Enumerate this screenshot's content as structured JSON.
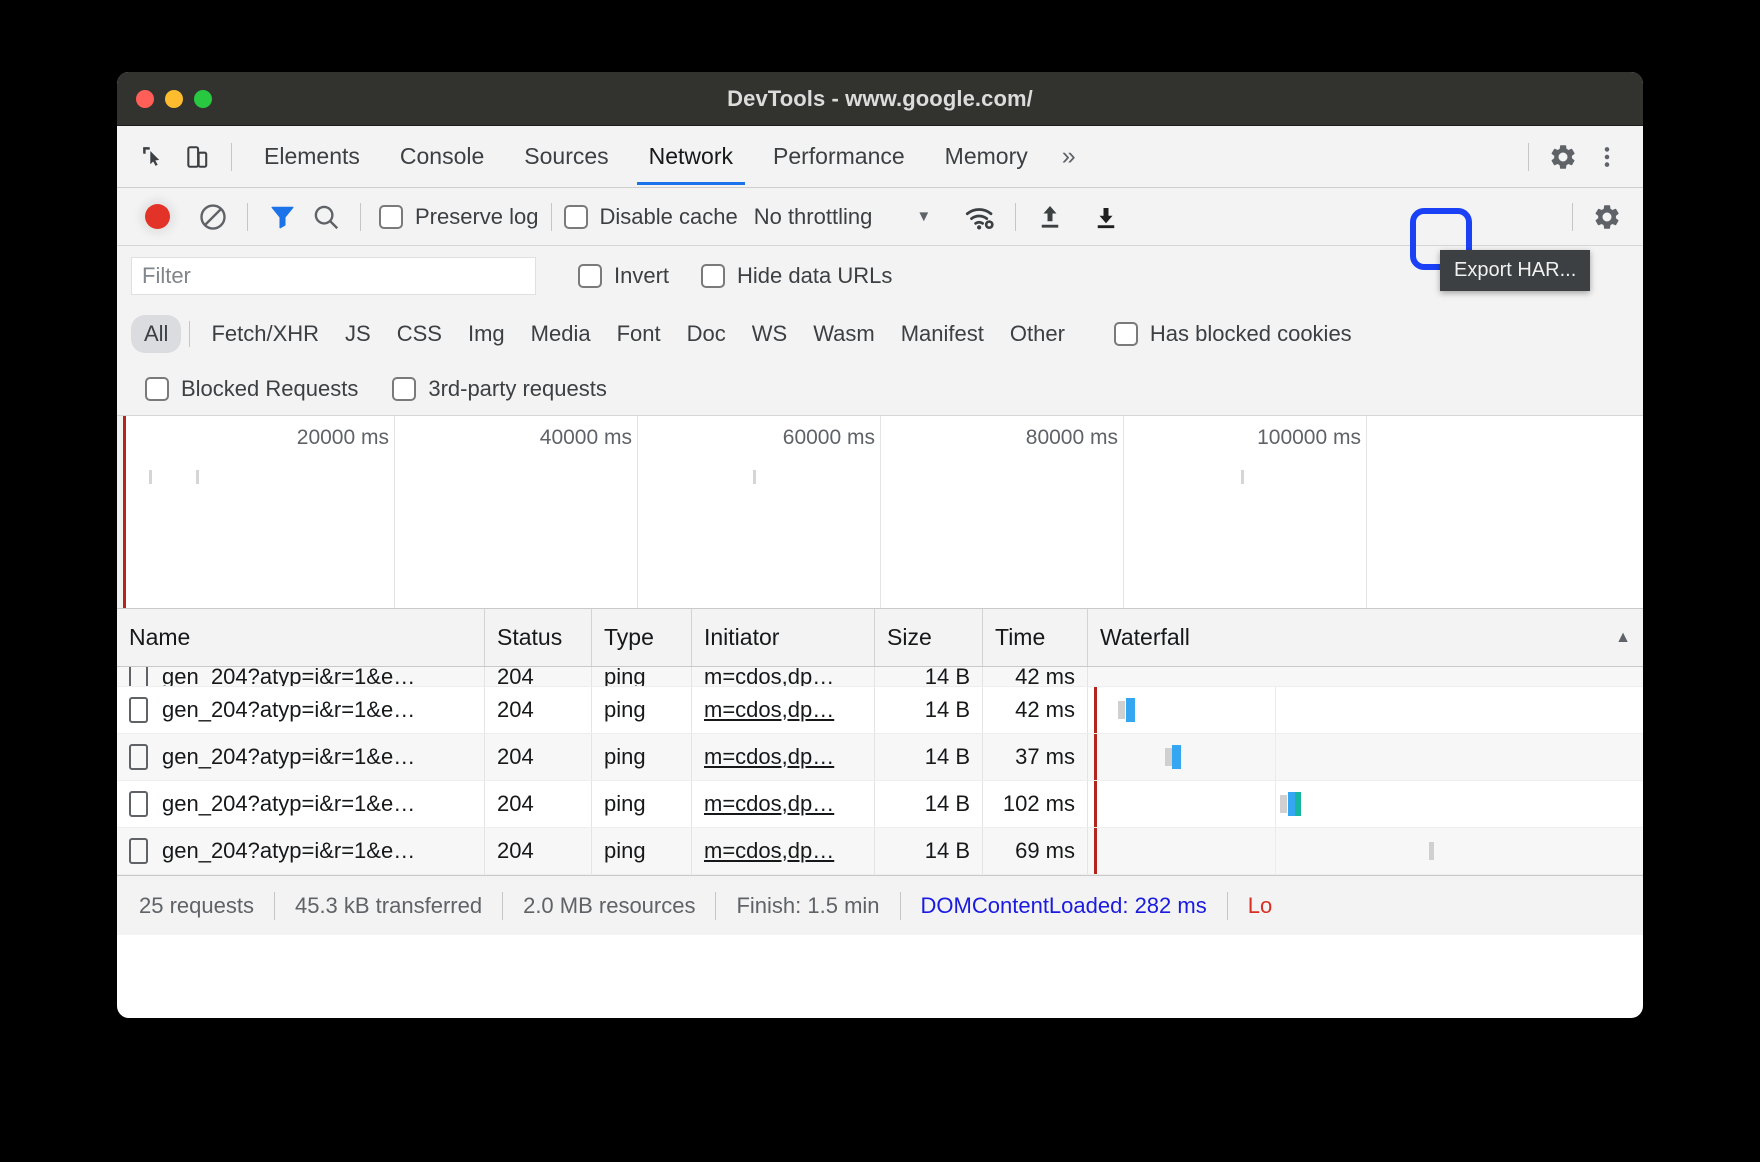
{
  "window": {
    "title": "DevTools - www.google.com/",
    "traffic_lights": [
      "close",
      "minimize",
      "zoom"
    ]
  },
  "tabbar": {
    "left_icons": [
      {
        "name": "inspect-element-icon"
      },
      {
        "name": "device-toolbar-icon"
      }
    ],
    "tabs": [
      {
        "label": "Elements",
        "active": false
      },
      {
        "label": "Console",
        "active": false
      },
      {
        "label": "Sources",
        "active": false
      },
      {
        "label": "Network",
        "active": true
      },
      {
        "label": "Performance",
        "active": false
      },
      {
        "label": "Memory",
        "active": false
      }
    ],
    "more_tabs": "»",
    "right_icons": [
      {
        "name": "settings-gear-icon"
      },
      {
        "name": "more-options-icon"
      }
    ]
  },
  "network_toolbar": {
    "record_button": "record-stop-button",
    "clear_button": "clear-button",
    "filter_toggle": "filter-funnel-icon",
    "search_button": "search-icon",
    "preserve_log": {
      "label": "Preserve log",
      "checked": false
    },
    "disable_cache": {
      "label": "Disable cache",
      "checked": false
    },
    "throttling": {
      "value": "No throttling",
      "caret": "▼"
    },
    "network_conditions": "wifi-settings-icon",
    "import_har": "import-har-icon",
    "export_har": "export-har-icon",
    "settings": "settings-gear-icon",
    "tooltip": "Export HAR..."
  },
  "filter_bar": {
    "input_placeholder": "Filter",
    "input_value": "",
    "invert": {
      "label": "Invert",
      "checked": false
    },
    "hide_data_urls": {
      "label": "Hide data URLs",
      "checked": false
    }
  },
  "type_filters": {
    "all": "All",
    "types": [
      "Fetch/XHR",
      "JS",
      "CSS",
      "Img",
      "Media",
      "Font",
      "Doc",
      "WS",
      "Wasm",
      "Manifest",
      "Other"
    ],
    "has_blocked_cookies": {
      "label": "Has blocked cookies",
      "checked": false
    },
    "blocked_requests": {
      "label": "Blocked Requests",
      "checked": false
    },
    "third_party_requests": {
      "label": "3rd-party requests",
      "checked": false
    }
  },
  "overview": {
    "ticks": [
      "20000 ms",
      "40000 ms",
      "60000 ms",
      "80000 ms",
      "100000 ms"
    ]
  },
  "table": {
    "columns": [
      "Name",
      "Status",
      "Type",
      "Initiator",
      "Size",
      "Time",
      "Waterfall"
    ],
    "sort_indicator": "▲",
    "rows": [
      {
        "name": "gen_204?atyp=i&r=1&e…",
        "status": "204",
        "type": "ping",
        "initiator": "m=cdos,dp…",
        "size": "14 B",
        "time": "42 ms"
      },
      {
        "name": "gen_204?atyp=i&r=1&e…",
        "status": "204",
        "type": "ping",
        "initiator": "m=cdos,dp…",
        "size": "14 B",
        "time": "37 ms"
      },
      {
        "name": "gen_204?atyp=i&r=1&e…",
        "status": "204",
        "type": "ping",
        "initiator": "m=cdos,dp…",
        "size": "14 B",
        "time": "102 ms"
      },
      {
        "name": "gen_204?atyp=i&r=1&e…",
        "status": "204",
        "type": "ping",
        "initiator": "m=cdos,dp…",
        "size": "14 B",
        "time": "69 ms"
      }
    ]
  },
  "status_bar": {
    "requests": "25 requests",
    "transferred": "45.3 kB transferred",
    "resources": "2.0 MB resources",
    "finish": "Finish: 1.5 min",
    "dom_content_loaded": "DOMContentLoaded: 282 ms",
    "load": "Lo"
  },
  "colors": {
    "accent": "#1a73e8",
    "record": "#e33227",
    "focus_ring": "#1a41f5",
    "waterfall_blue": "#35a7f2",
    "waterfall_teal": "#18b5a2",
    "redline": "#b3261e",
    "dcl_blue": "#1a1ae0",
    "load_red": "#d93025"
  }
}
